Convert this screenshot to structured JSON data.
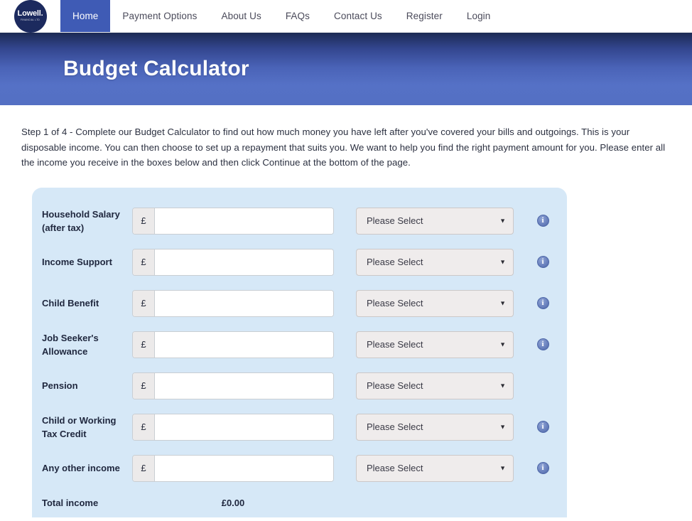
{
  "nav": {
    "logo": {
      "word": "Lowell.",
      "sub": "FINANCIAL LTD",
      "icon": "lowell-logo-icon"
    },
    "items": [
      {
        "label": "Home",
        "active": true
      },
      {
        "label": "Payment Options",
        "active": false
      },
      {
        "label": "About Us",
        "active": false
      },
      {
        "label": "FAQs",
        "active": false
      },
      {
        "label": "Contact Us",
        "active": false
      },
      {
        "label": "Register",
        "active": false
      },
      {
        "label": "Login",
        "active": false
      }
    ]
  },
  "hero": {
    "title": "Budget Calculator",
    "gradient_top": "#1c2a54",
    "gradient_bottom": "#5470c3"
  },
  "intro": {
    "text": "Step 1 of 4 - Complete our Budget Calculator to find out how much money you have left after you've covered your bills and outgoings. This is your disposable income. You can then choose to set up a repayment that suits you. We want to help you find the right payment amount for you. Please enter all the income you receive in the boxes below and then click Continue at the bottom of the page."
  },
  "form": {
    "panel_color": "#d6e8f7",
    "currency_symbol": "£",
    "select_placeholder": "Please Select",
    "select_caret": "▼",
    "info_glyph": "i",
    "rows": [
      {
        "label": "Household Salary (after tax)",
        "amount": "",
        "frequency": "Please Select",
        "has_info": true
      },
      {
        "label": "Income Support",
        "amount": "",
        "frequency": "Please Select",
        "has_info": true
      },
      {
        "label": "Child Benefit",
        "amount": "",
        "frequency": "Please Select",
        "has_info": true
      },
      {
        "label": "Job Seeker's Allowance",
        "amount": "",
        "frequency": "Please Select",
        "has_info": true
      },
      {
        "label": "Pension",
        "amount": "",
        "frequency": "Please Select",
        "has_info": false
      },
      {
        "label": "Child or Working Tax Credit",
        "amount": "",
        "frequency": "Please Select",
        "has_info": true
      },
      {
        "label": "Any other income",
        "amount": "",
        "frequency": "Please Select",
        "has_info": true
      }
    ],
    "total": {
      "label": "Total income",
      "value": "£0.00"
    }
  }
}
